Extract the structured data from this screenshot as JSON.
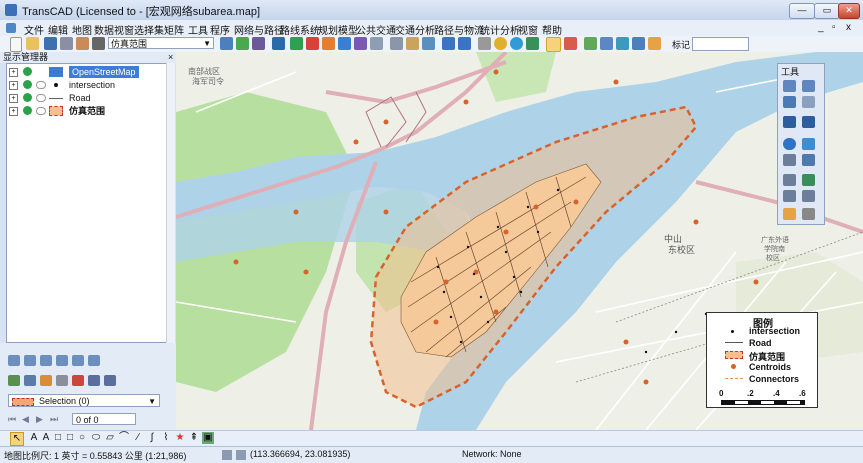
{
  "window": {
    "title": "TransCAD (Licensed to                    - [宏观网络subarea.map]",
    "controls": [
      "—",
      "▭",
      "✕"
    ]
  },
  "menu": [
    "文件",
    "编辑",
    "地图",
    "数据视窗",
    "选择集",
    "矩阵",
    "工具",
    "程序",
    "网络与路径",
    "路线系统",
    "规划模型",
    "公共交通",
    "交通分析",
    "路径与物流",
    "统计分析",
    "视窗",
    "帮助"
  ],
  "mdi_controls": [
    "_",
    "▫",
    "x"
  ],
  "toolbar": {
    "layer_select": "仿真范围",
    "mark_label": "标记"
  },
  "layer_manager": {
    "title": "显示管理器",
    "close": "×",
    "layers": [
      {
        "name": "OpenStreetMap",
        "selected": true
      },
      {
        "name": "intersection",
        "selected": false
      },
      {
        "name": "Road",
        "selected": false
      },
      {
        "name": "仿真范围",
        "selected": false
      }
    ]
  },
  "selection": {
    "label": "Selection (0)",
    "page": "0 of 0"
  },
  "tools_palette": {
    "title": "工具"
  },
  "legend": {
    "title": "图例",
    "items": [
      {
        "label": "intersection"
      },
      {
        "label": "Road"
      },
      {
        "label": "仿真范围"
      },
      {
        "label": "Centroids"
      },
      {
        "label": "Connectors"
      }
    ],
    "scale": [
      "0",
      ".2",
      ".4",
      ".6"
    ]
  },
  "map_labels": [
    "南部战区",
    "海军司令",
    "中山",
    "东校区",
    "广东外语",
    "学院南",
    "校区"
  ],
  "status": {
    "scale": "地图比例尺: 1 英寸 = 0.55843 公里 (1:21,986)",
    "coords": "(113.366694, 23.081935)",
    "network": "Network: None"
  },
  "colors": {
    "boundary_fill": "#f3c08e",
    "boundary_stroke": "#d9622b",
    "river": "#aed2e8",
    "park": "#b7dfa0",
    "road": "#e0aeb7",
    "centroid": "#d9622b"
  }
}
